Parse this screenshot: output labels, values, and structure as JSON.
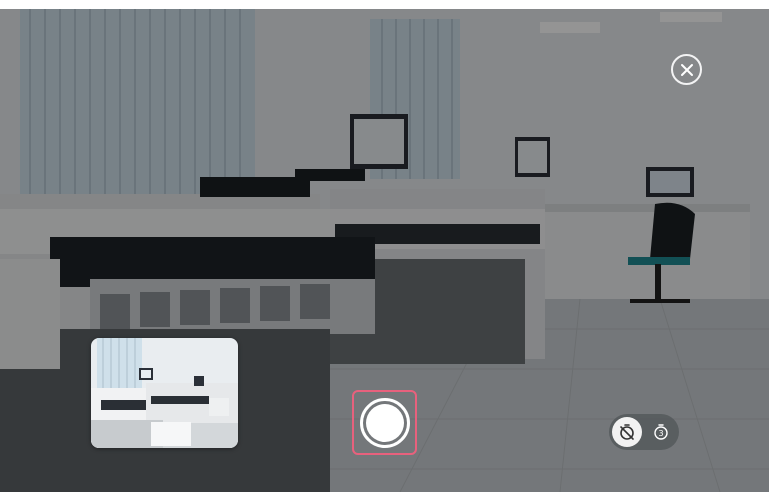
{
  "camera": {
    "close_icon": "close-icon",
    "shutter_icon": "shutter-button",
    "timer_options": [
      {
        "icon": "timer-off-icon",
        "selected": true
      },
      {
        "icon": "timer-3-icon",
        "label": "3",
        "selected": false
      }
    ],
    "accent_focus_color": "#e8617d"
  }
}
